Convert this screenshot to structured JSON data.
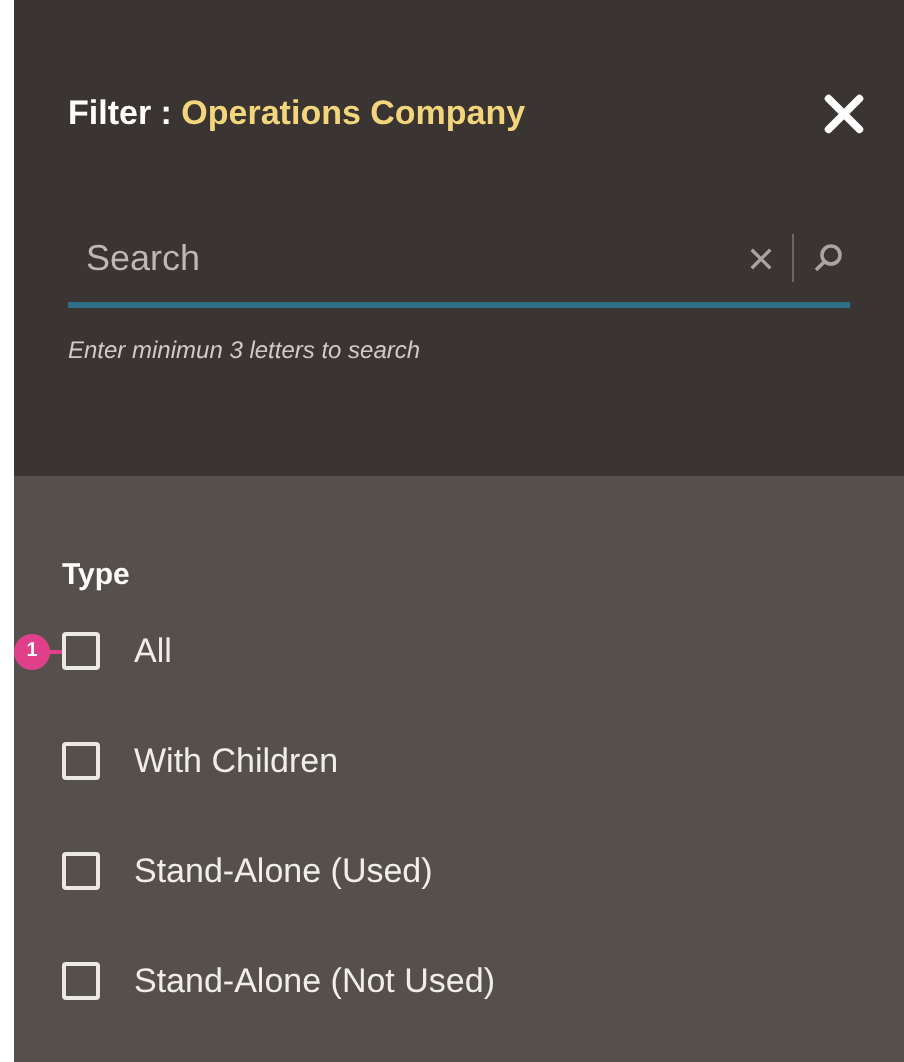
{
  "header": {
    "label": "Filter :",
    "value": "Operations Company"
  },
  "search": {
    "placeholder": "Search",
    "hint": "Enter minimun 3 letters to search"
  },
  "type_section": {
    "title": "Type",
    "options": [
      {
        "label": "All",
        "checked": false,
        "callout": "1"
      },
      {
        "label": "With Children",
        "checked": false
      },
      {
        "label": "Stand-Alone (Used)",
        "checked": false
      },
      {
        "label": "Stand-Alone (Not Used)",
        "checked": false
      }
    ]
  }
}
